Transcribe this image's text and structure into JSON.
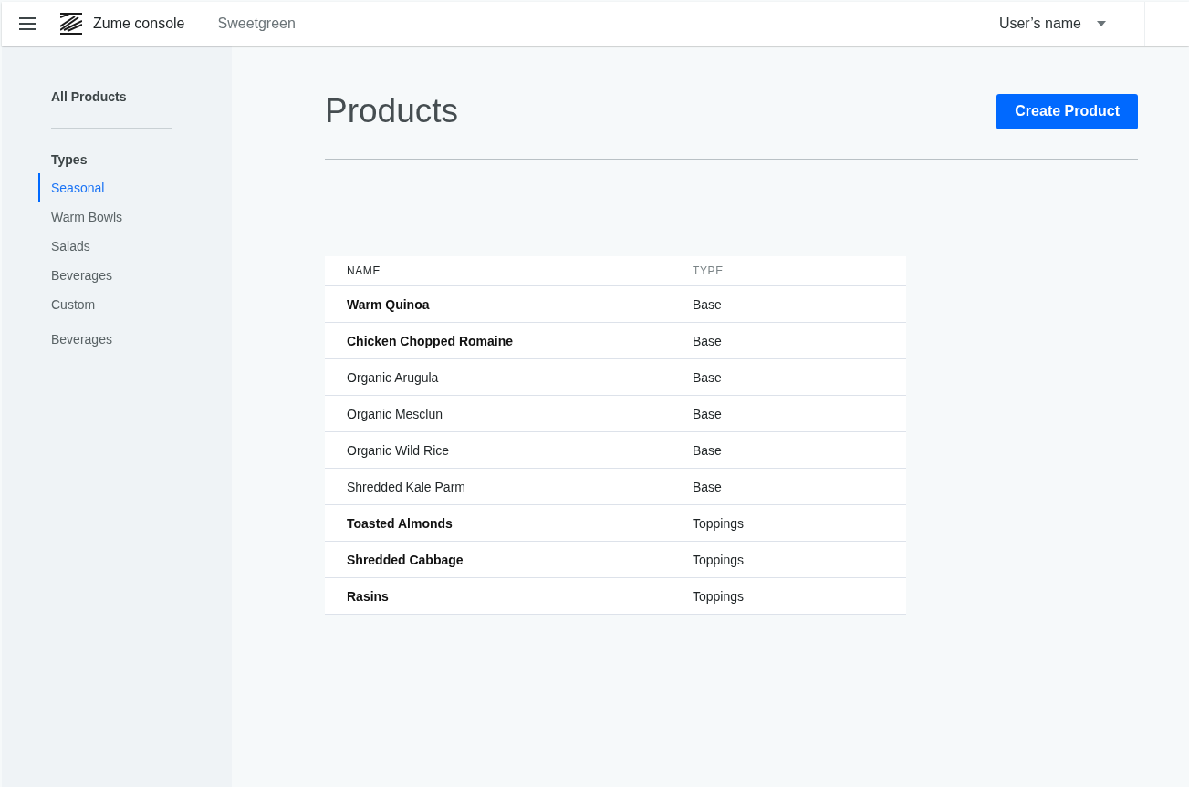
{
  "header": {
    "app_name": "Zume console",
    "organization": "Sweetgreen",
    "user_name": "User’s name"
  },
  "sidebar": {
    "title": "All Products",
    "section": {
      "heading": "Types",
      "items": [
        {
          "label": "Seasonal",
          "selected": true
        },
        {
          "label": "Warm Bowls",
          "selected": false
        },
        {
          "label": "Salads",
          "selected": false
        },
        {
          "label": "Beverages",
          "selected": false
        },
        {
          "label": "Custom",
          "selected": false
        }
      ]
    },
    "extra_items": [
      {
        "label": "Beverages",
        "selected": false
      }
    ]
  },
  "page": {
    "title": "Products",
    "primary_button": "Create Product"
  },
  "table": {
    "columns": [
      {
        "label": "NAME",
        "sorted": true
      },
      {
        "label": "TYPE",
        "sorted": false
      }
    ],
    "rows": [
      {
        "name": "Warm Quinoa",
        "type": "Base",
        "emphasized": true
      },
      {
        "name": "Chicken Chopped Romaine",
        "type": "Base",
        "emphasized": true
      },
      {
        "name": "Organic Arugula",
        "type": "Base",
        "emphasized": false
      },
      {
        "name": "Organic Mesclun",
        "type": "Base",
        "emphasized": false
      },
      {
        "name": "Organic Wild Rice",
        "type": "Base",
        "emphasized": false
      },
      {
        "name": "Shredded Kale Parm",
        "type": "Base",
        "emphasized": false
      },
      {
        "name": "Toasted Almonds",
        "type": "Toppings",
        "emphasized": true
      },
      {
        "name": "Shredded Cabbage",
        "type": "Toppings",
        "emphasized": true
      },
      {
        "name": "Rasins",
        "type": "Toppings",
        "emphasized": true
      }
    ]
  }
}
